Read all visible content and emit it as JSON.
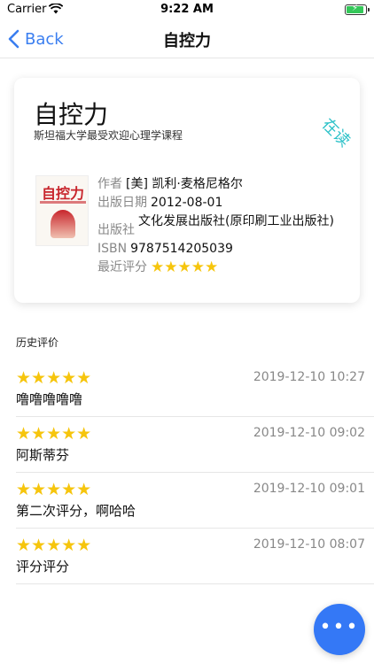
{
  "status": {
    "carrier": "Carrier",
    "time": "9:22 AM",
    "battery_color": "#34c759"
  },
  "nav": {
    "back_label": "Back",
    "title": "自控力"
  },
  "book": {
    "title": "自控力",
    "subtitle": "斯坦福大学最受欢迎心理学课程",
    "status_badge": "在读",
    "cover_text": "自控力",
    "author_label": "作者",
    "author": "[美] 凯利·麦格尼格尔",
    "date_label": "出版日期",
    "date": "2012-08-01",
    "publisher_label": "出版社",
    "publisher": "文化发展出版社(原印刷工业出版社)",
    "isbn_label": "ISBN",
    "isbn": "9787514205039",
    "rating_label": "最近评分",
    "rating_stars": "★★★★★",
    "rating_value": 5
  },
  "history": {
    "heading": "历史评价",
    "items": [
      {
        "stars": "★★★★★",
        "rating": 5,
        "time": "2019-12-10 10:27",
        "text": "噜噜噜噜噜"
      },
      {
        "stars": "★★★★★",
        "rating": 5,
        "time": "2019-12-10 09:02",
        "text": "阿斯蒂芬"
      },
      {
        "stars": "★★★★★",
        "rating": 5,
        "time": "2019-12-10 09:01",
        "text": "第二次评分，啊哈哈"
      },
      {
        "stars": "★★★★★",
        "rating": 5,
        "time": "2019-12-10 08:07",
        "text": "评分评分"
      }
    ]
  },
  "fab": {
    "label": "•••",
    "icon": "more-icon",
    "color": "#3478f6"
  },
  "colors": {
    "accent": "#3a7ef0",
    "star": "#f6c50d",
    "badge": "#2bc1c8"
  }
}
